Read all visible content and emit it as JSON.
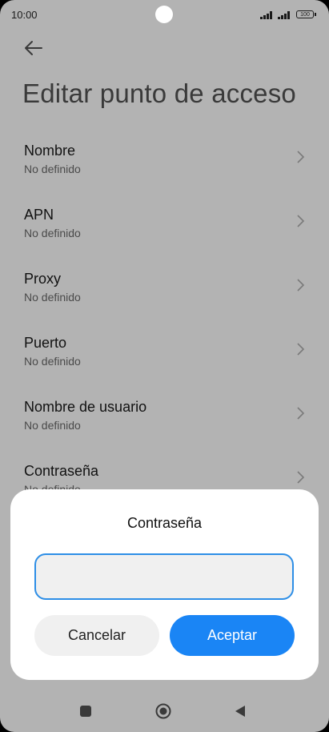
{
  "status_bar": {
    "time": "10:00",
    "battery": "100"
  },
  "page": {
    "title": "Editar punto de acceso"
  },
  "settings": [
    {
      "label": "Nombre",
      "value": "No definido"
    },
    {
      "label": "APN",
      "value": "No definido"
    },
    {
      "label": "Proxy",
      "value": "No definido"
    },
    {
      "label": "Puerto",
      "value": "No definido"
    },
    {
      "label": "Nombre de usuario",
      "value": "No definido"
    },
    {
      "label": "Contraseña",
      "value": "No definido"
    }
  ],
  "dialog": {
    "title": "Contraseña",
    "input_value": "",
    "cancel_label": "Cancelar",
    "accept_label": "Aceptar"
  },
  "icons": {
    "back": "arrow-left-icon",
    "chevron": "chevron-right-icon",
    "nav_recents": "square-icon",
    "nav_home": "circle-icon",
    "nav_back": "triangle-icon"
  },
  "colors": {
    "accent": "#1a85f5",
    "input_border": "#2d8ee6"
  }
}
